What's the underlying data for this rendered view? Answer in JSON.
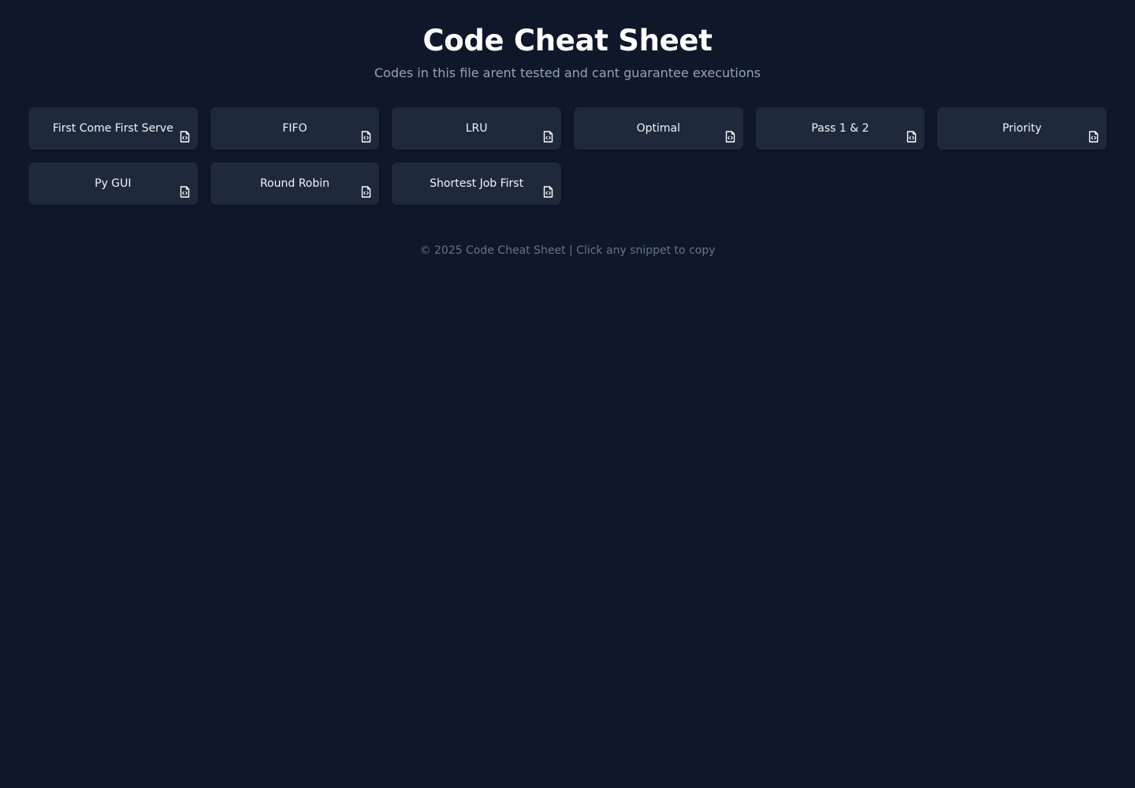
{
  "header": {
    "title": "Code Cheat Sheet",
    "subtitle": "Codes in this file arent tested and cant guarantee executions"
  },
  "snippets": [
    {
      "label": "First Come First Serve",
      "icon": "file-code-icon"
    },
    {
      "label": "FIFO",
      "icon": "file-code-icon"
    },
    {
      "label": "LRU",
      "icon": "file-code-icon"
    },
    {
      "label": "Optimal",
      "icon": "file-code-icon"
    },
    {
      "label": "Pass 1 & 2",
      "icon": "file-code-icon"
    },
    {
      "label": "Priority",
      "icon": "file-code-icon"
    },
    {
      "label": "Py GUI",
      "icon": "file-code-icon"
    },
    {
      "label": "Round Robin",
      "icon": "file-code-icon"
    },
    {
      "label": "Shortest Job First",
      "icon": "file-code-icon"
    }
  ],
  "footer": {
    "text": "© 2025 Code Cheat Sheet | Click any snippet to copy"
  },
  "colors": {
    "background": "#0f172a",
    "card": "#1e293b",
    "subtitle": "#94a3b8",
    "footer": "#64748b"
  }
}
